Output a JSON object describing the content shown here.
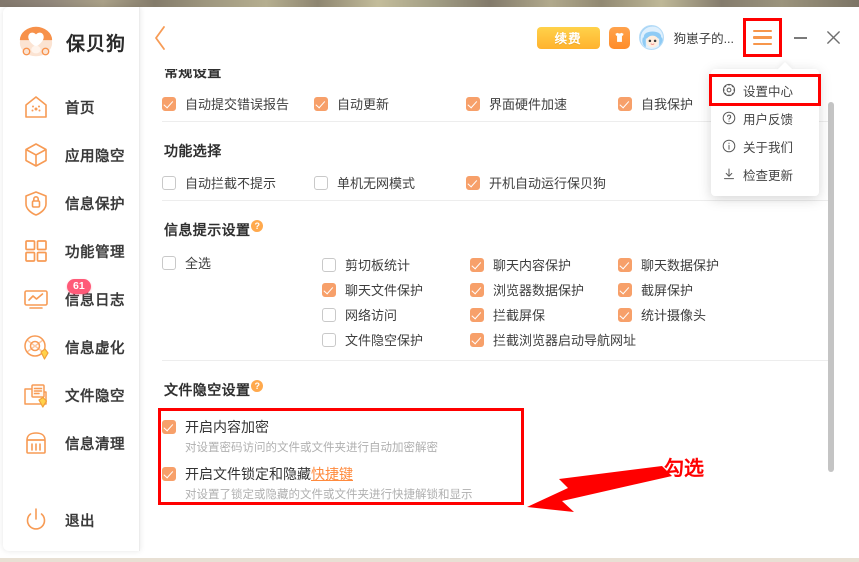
{
  "app": {
    "brand_name": "保贝狗",
    "brand_logo_icon": "dog-logo-icon"
  },
  "sidebar": {
    "items": [
      {
        "label": "首页",
        "icon": "home-icon"
      },
      {
        "label": "应用隐空",
        "icon": "cube-icon"
      },
      {
        "label": "信息保护",
        "icon": "shield-lock-icon"
      },
      {
        "label": "功能管理",
        "icon": "grid-squares-icon"
      },
      {
        "label": "信息日志",
        "icon": "chart-monitor-icon",
        "badge": "61"
      },
      {
        "label": "信息虚化",
        "icon": "camera-blur-icon"
      },
      {
        "label": "文件隐空",
        "icon": "folder-file-icon"
      },
      {
        "label": "信息清理",
        "icon": "broom-clean-icon"
      }
    ],
    "logout": {
      "label": "退出",
      "icon": "power-icon"
    }
  },
  "topbar": {
    "back_icon": "chevron-left-icon",
    "renew_label": "续费",
    "shirt_icon": "tshirt-gift-icon",
    "avatar_icon": "user-avatar",
    "username": "狗崽子的...",
    "menu_icon": "hamburger-menu-icon",
    "minimize_icon": "minimize-icon",
    "close_icon": "close-icon"
  },
  "dropdown": {
    "items": [
      {
        "label": "设置中心",
        "icon": "gear-icon",
        "highlighted": true
      },
      {
        "label": "用户反馈",
        "icon": "question-circle-icon",
        "highlighted": false
      },
      {
        "label": "关于我们",
        "icon": "info-circle-icon",
        "highlighted": false
      },
      {
        "label": "检查更新",
        "icon": "download-icon",
        "highlighted": false
      }
    ]
  },
  "content": {
    "general": {
      "title": "常规设置",
      "items": [
        {
          "label": "自动提交错误报告",
          "checked": true
        },
        {
          "label": "自动更新",
          "checked": true
        },
        {
          "label": "界面硬件加速",
          "checked": true
        },
        {
          "label": "自我保护",
          "checked": true
        }
      ]
    },
    "features": {
      "title": "功能选择",
      "items": [
        {
          "label": "自动拦截不提示",
          "checked": false
        },
        {
          "label": "单机无网模式",
          "checked": false
        },
        {
          "label": "开机自动运行保贝狗",
          "checked": true
        }
      ]
    },
    "tips": {
      "title": "信息提示设置",
      "help_icon": "question-badge-icon",
      "select_all": {
        "label": "全选",
        "checked": false
      },
      "columns": [
        [
          {
            "label": "剪切板统计",
            "checked": false
          },
          {
            "label": "聊天文件保护",
            "checked": true
          },
          {
            "label": "网络访问",
            "checked": false
          },
          {
            "label": "文件隐空保护",
            "checked": false
          }
        ],
        [
          {
            "label": "聊天内容保护",
            "checked": true
          },
          {
            "label": "浏览器数据保护",
            "checked": true
          },
          {
            "label": "拦截屏保",
            "checked": true
          },
          {
            "label": "拦截浏览器启动导航网址",
            "checked": true
          }
        ],
        [
          {
            "label": "聊天数据保护",
            "checked": true
          },
          {
            "label": "截屏保护",
            "checked": true
          },
          {
            "label": "统计摄像头",
            "checked": true
          }
        ]
      ]
    },
    "file_hide": {
      "title": "文件隐空设置",
      "help_icon": "question-badge-icon",
      "items": [
        {
          "label": "开启内容加密",
          "link": "",
          "desc": "对设置密码访问的文件或文件夹进行自动加密解密",
          "checked": true
        },
        {
          "label": "开启文件锁定和隐藏",
          "link": "快捷键",
          "desc": "对设置了锁定或隐藏的文件或文件夹进行快捷解锁和显示",
          "checked": true
        }
      ]
    }
  },
  "annotations": {
    "arrow_label": "勾选",
    "arrow_color": "#FF0000",
    "highlight_color": "#FF0000"
  },
  "colors": {
    "accent_orange": "#F7964B",
    "checkbox_checked": "#F7A06A",
    "badge_red": "#FF5A78",
    "link_orange": "#FF8A3D",
    "renew_yellow": "#FFC73A"
  }
}
